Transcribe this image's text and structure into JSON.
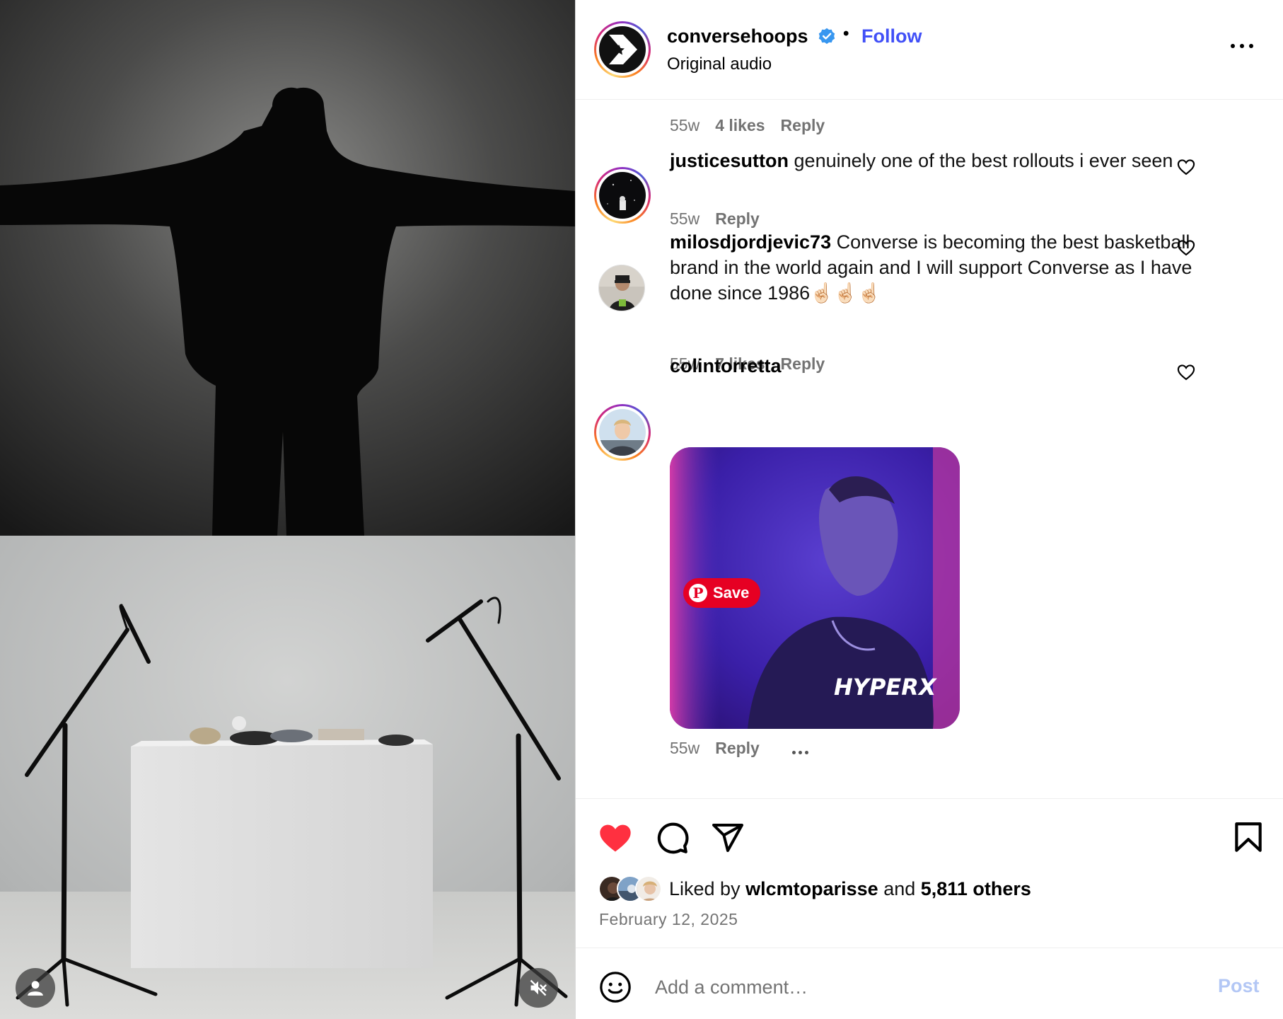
{
  "post": {
    "username": "conversehoops",
    "follow_label": "Follow",
    "dot": "•",
    "audio": "Original audio"
  },
  "comments": {
    "prev": {
      "time": "55w",
      "likes": "4 likes",
      "reply": "Reply"
    },
    "items": [
      {
        "username": "justicesutton",
        "text": "genuinely one of the best rollouts i ever seen",
        "time": "55w",
        "likes": "",
        "reply": "Reply"
      },
      {
        "username": "milosdjordjevic73",
        "text": "Converse is becoming the best basketball brand in the world again and I will support Converse as I have done since 1986☝🏻☝🏻☝🏻",
        "time": "55w",
        "likes": "7 likes",
        "reply": "Reply"
      },
      {
        "username": "colintorretta",
        "text": "",
        "time": "55w",
        "likes": "",
        "reply": "Reply",
        "gif_brand": "HYPERX",
        "save_label": "Save"
      }
    ]
  },
  "likes": {
    "prefix": "Liked by",
    "user": "wlcmtoparisse",
    "joiner": "and",
    "others": "5,811 others"
  },
  "date": "February 12, 2025",
  "composer": {
    "placeholder": "Add a comment…",
    "post_label": "Post"
  },
  "colors": {
    "follow": "#4150f7",
    "like_heart": "#ff3040",
    "post_disabled": "#b3c7f5",
    "meta_gray": "#737373"
  },
  "icons": [
    "verified-icon",
    "more-options-icon",
    "heart-icon",
    "comment-icon",
    "share-icon",
    "bookmark-icon",
    "emoji-icon",
    "user-tag-icon",
    "muted-speaker-icon",
    "pinterest-icon"
  ]
}
